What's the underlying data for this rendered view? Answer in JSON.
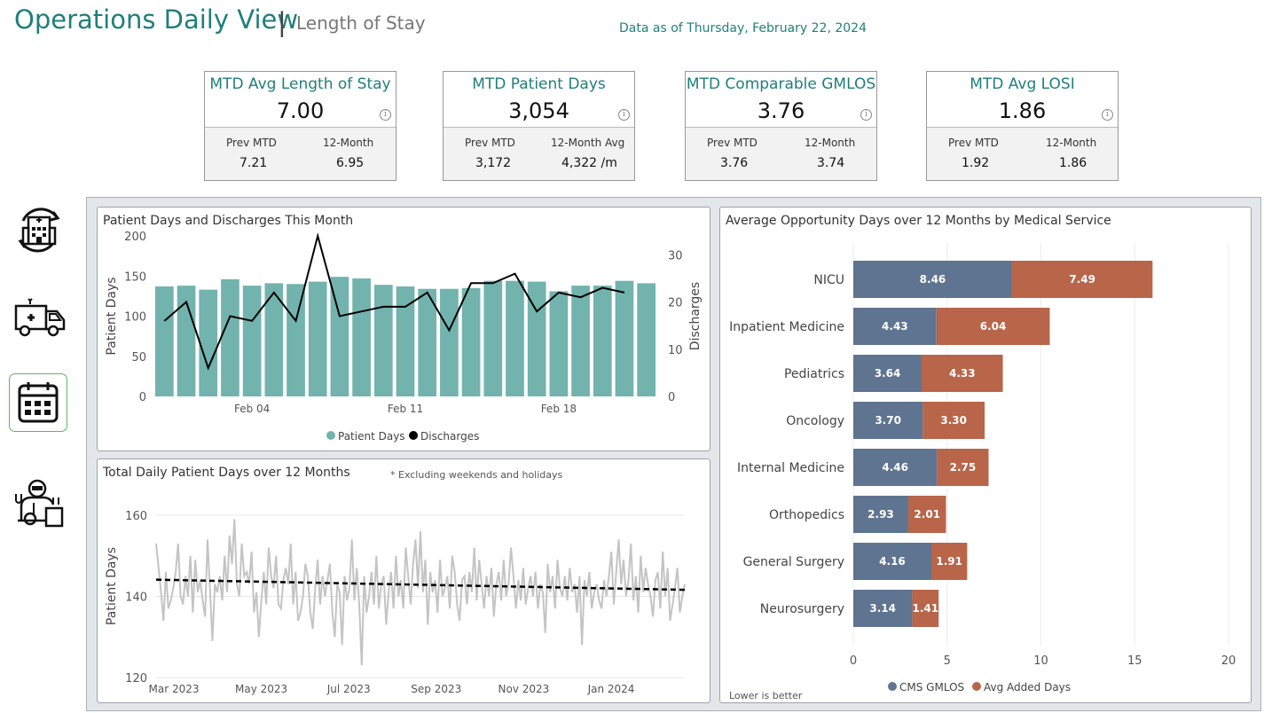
{
  "header": {
    "title": "Operations Daily View",
    "separator": "|",
    "subtitle": "Length of Stay",
    "data_as_of": "Data as of Thursday, February 22, 2024"
  },
  "colors": {
    "accent": "#1f7f7a",
    "bar_teal": "#72b3ae",
    "cms": "#5f7490",
    "added": "#b8654a"
  },
  "kpis": [
    {
      "title": "MTD Avg Length of Stay",
      "value": "7.00",
      "left_label": "Prev MTD",
      "left_value": "7.21",
      "right_label": "12-Month",
      "right_value": "6.95"
    },
    {
      "title": "MTD Patient Days",
      "value": "3,054",
      "left_label": "Prev MTD",
      "left_value": "3,172",
      "right_label": "12-Month Avg",
      "right_value": "4,322 /m"
    },
    {
      "title": "MTD Comparable GMLOS",
      "value": "3.76",
      "left_label": "Prev MTD",
      "left_value": "3.76",
      "right_label": "12-Month",
      "right_value": "3.74"
    },
    {
      "title": "MTD Avg LOSI",
      "value": "1.86",
      "left_label": "Prev MTD",
      "left_value": "1.92",
      "right_label": "12-Month",
      "right_value": "1.86"
    }
  ],
  "info_glyph": "i",
  "nav": [
    {
      "name": "hospital-cycle-icon"
    },
    {
      "name": "ambulance-icon"
    },
    {
      "name": "calendar-icon"
    },
    {
      "name": "doctor-icon"
    }
  ],
  "chart_data": [
    {
      "type": "bar",
      "title": "Patient Days and Discharges This Month",
      "ylabel": "Patient Days",
      "y2label": "Discharges",
      "x_tick_labels": [
        "Feb 04",
        "Feb 11",
        "Feb 18"
      ],
      "x_tick_index": [
        4,
        11,
        18
      ],
      "ylim": [
        0,
        200
      ],
      "yticks": [
        0,
        50,
        100,
        150,
        200
      ],
      "y2lim": [
        0,
        34
      ],
      "y2ticks": [
        0,
        10,
        20,
        30
      ],
      "legend": [
        "Patient Days",
        "Discharges"
      ],
      "series": [
        {
          "name": "Patient Days",
          "type": "bar",
          "values": [
            137,
            138,
            133,
            146,
            138,
            141,
            140,
            143,
            149,
            147,
            139,
            137,
            134,
            134,
            135,
            144,
            144,
            143,
            131,
            138,
            138,
            144,
            141
          ]
        },
        {
          "name": "Discharges",
          "type": "line",
          "values": [
            16,
            20,
            6,
            17,
            16,
            22,
            16,
            34,
            17,
            18,
            19,
            19,
            22,
            14,
            24,
            24,
            26,
            18,
            22,
            21,
            23,
            22
          ]
        }
      ]
    },
    {
      "type": "line",
      "title": "Total Daily Patient Days over 12 Months",
      "note": "* Excluding weekends and holidays",
      "ylabel": "Patient Days",
      "ylim": [
        120,
        165
      ],
      "yticks": [
        120,
        140,
        160
      ],
      "x_tick_labels": [
        "Mar 2023",
        "May 2023",
        "Jul 2023",
        "Sep 2023",
        "Nov 2023",
        "Jan 2024"
      ],
      "trend": [
        144.1,
        141.6
      ],
      "series": [
        {
          "name": "Total Daily Patient Days",
          "values": [
            153,
            147,
            141,
            134,
            146,
            137,
            139,
            142,
            146,
            153,
            140,
            138,
            145,
            140,
            150,
            136,
            149,
            141,
            144,
            139,
            135,
            154,
            142,
            129,
            143,
            141,
            145,
            139,
            150,
            141,
            155,
            148,
            159,
            143,
            140,
            153,
            145,
            146,
            143,
            151,
            136,
            141,
            130,
            139,
            146,
            138,
            152,
            145,
            142,
            150,
            138,
            137,
            144,
            147,
            143,
            153,
            138,
            146,
            134,
            136,
            140,
            148,
            145,
            136,
            132,
            142,
            149,
            138,
            145,
            140,
            144,
            148,
            136,
            130,
            143,
            141,
            128,
            145,
            139,
            142,
            154,
            139,
            147,
            138,
            123,
            145,
            136,
            140,
            146,
            138,
            150,
            137,
            143,
            145,
            133,
            141,
            146,
            137,
            150,
            140,
            144,
            137,
            152,
            145,
            138,
            148,
            154,
            142,
            156,
            141,
            149,
            133,
            146,
            141,
            144,
            136,
            149,
            140,
            142,
            145,
            137,
            150,
            146,
            138,
            134,
            144,
            145,
            138,
            146,
            141,
            152,
            139,
            149,
            143,
            137,
            145,
            140,
            147,
            135,
            143,
            146,
            139,
            149,
            140,
            143,
            152,
            145,
            137,
            144,
            139,
            147,
            138,
            142,
            145,
            140,
            146,
            137,
            143,
            141,
            131,
            148,
            141,
            145,
            137,
            149,
            142,
            140,
            145,
            139,
            147,
            141,
            143,
            136,
            145,
            128,
            144,
            140,
            146,
            137,
            141,
            143,
            139,
            137,
            144,
            140,
            145,
            151,
            138,
            146,
            154,
            143,
            149,
            140,
            144,
            153,
            139,
            145,
            136,
            150,
            141,
            147,
            143,
            140,
            135,
            144,
            146,
            137,
            151,
            140,
            147,
            134,
            138,
            142,
            147,
            136,
            140,
            143
          ]
        }
      ]
    },
    {
      "type": "bar",
      "orientation": "horizontal",
      "stacked": true,
      "title": "Average Opportunity Days over 12 Months by Medical Service",
      "note": "Lower is better",
      "categories": [
        "NICU",
        "Inpatient Medicine",
        "Pediatrics",
        "Oncology",
        "Internal Medicine",
        "Orthopedics",
        "General Surgery",
        "Neurosurgery"
      ],
      "xlim": [
        0,
        20
      ],
      "xticks": [
        0,
        5,
        10,
        15,
        20
      ],
      "legend": [
        "CMS GMLOS",
        "Avg Added Days"
      ],
      "series": [
        {
          "name": "CMS GMLOS",
          "values": [
            8.46,
            4.43,
            3.64,
            3.7,
            4.46,
            2.93,
            4.16,
            3.14
          ],
          "labels": [
            "8.46",
            "4.43",
            "3.64",
            "3.70",
            "4.46",
            "2.93",
            "4.16",
            "3.14"
          ]
        },
        {
          "name": "Avg Added Days",
          "values": [
            7.49,
            6.04,
            4.33,
            3.3,
            2.75,
            2.01,
            1.91,
            1.41
          ],
          "labels": [
            "7.49",
            "6.04",
            "4.33",
            "3.30",
            "2.75",
            "2.01",
            "1.91",
            "1.41"
          ]
        }
      ]
    }
  ]
}
